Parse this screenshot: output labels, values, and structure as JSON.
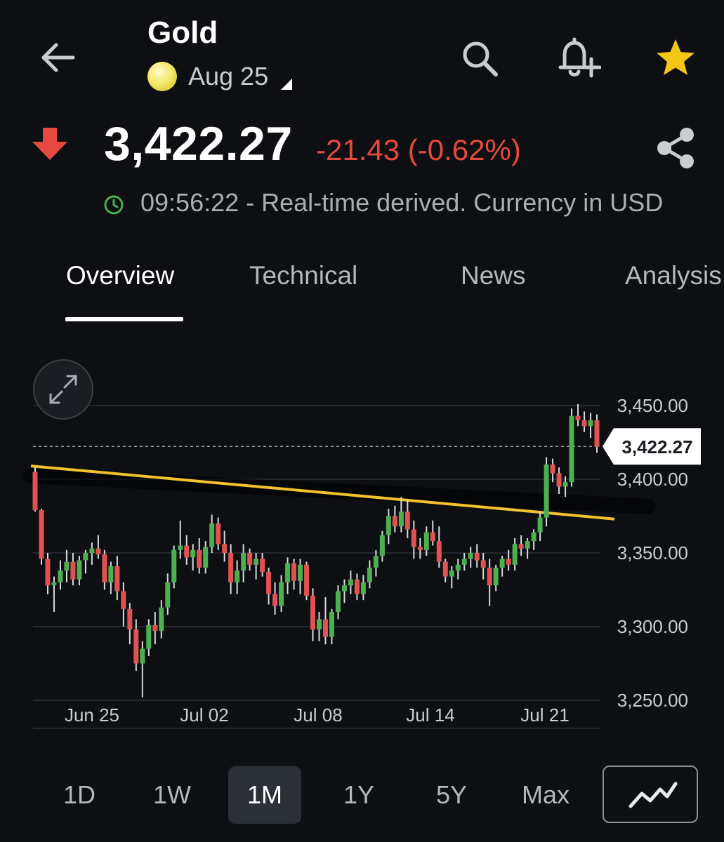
{
  "header": {
    "title": "Gold",
    "contract": "Aug 25",
    "back_icon": "arrow-left-icon",
    "search_icon": "search-icon",
    "alert_icon": "bell-plus-icon",
    "watchlist_icon": "star-icon",
    "star_color": "#f5c518"
  },
  "quote": {
    "price": "3,422.27",
    "change": "-21.43 (-0.62%)",
    "direction_icon": "arrow-down-icon",
    "share_icon": "share-icon",
    "down_color": "#e6493f"
  },
  "status": {
    "clock_icon": "clock-icon",
    "text": "09:56:22 - Real-time derived. Currency in USD"
  },
  "tabs": [
    {
      "label": "Overview",
      "active": true
    },
    {
      "label": "Technical"
    },
    {
      "label": "News"
    },
    {
      "label": "Analysis"
    }
  ],
  "chart_data": {
    "type": "candlestick",
    "y_ticks": [
      "3,450.00",
      "3,400.00",
      "3,350.00",
      "3,300.00",
      "3,250.00"
    ],
    "x_ticks": [
      "Jun 25",
      "Jul 02",
      "Jul 08",
      "Jul 14",
      "Jul 21"
    ],
    "ylim": [
      3250,
      3450
    ],
    "last_price_label": "3,422.27",
    "last_price": 3422.27,
    "up_color": "#4caf50",
    "down_color": "#e05252",
    "trendline_color": "#f2c12e",
    "trendline": [
      [
        0,
        3409
      ],
      [
        100,
        3373
      ]
    ],
    "candles": [
      [
        3405,
        3408,
        3378,
        3379
      ],
      [
        3379,
        3380,
        3342,
        3346
      ],
      [
        3346,
        3350,
        3322,
        3328
      ],
      [
        3328,
        3334,
        3310,
        3330
      ],
      [
        3330,
        3345,
        3325,
        3338
      ],
      [
        3338,
        3352,
        3330,
        3344
      ],
      [
        3344,
        3350,
        3328,
        3332
      ],
      [
        3332,
        3348,
        3328,
        3345
      ],
      [
        3345,
        3352,
        3336,
        3350
      ],
      [
        3350,
        3357,
        3342,
        3353
      ],
      [
        3353,
        3362,
        3346,
        3349
      ],
      [
        3349,
        3352,
        3325,
        3330
      ],
      [
        3330,
        3344,
        3322,
        3341
      ],
      [
        3341,
        3348,
        3318,
        3324
      ],
      [
        3324,
        3330,
        3300,
        3312
      ],
      [
        3312,
        3316,
        3288,
        3298
      ],
      [
        3298,
        3305,
        3270,
        3275
      ],
      [
        3275,
        3290,
        3252,
        3285
      ],
      [
        3285,
        3305,
        3280,
        3301
      ],
      [
        3301,
        3310,
        3288,
        3297
      ],
      [
        3297,
        3318,
        3292,
        3313
      ],
      [
        3313,
        3336,
        3308,
        3330
      ],
      [
        3330,
        3355,
        3326,
        3352
      ],
      [
        3352,
        3372,
        3346,
        3355
      ],
      [
        3355,
        3362,
        3342,
        3347
      ],
      [
        3347,
        3356,
        3338,
        3352
      ],
      [
        3352,
        3360,
        3336,
        3340
      ],
      [
        3340,
        3358,
        3336,
        3354
      ],
      [
        3354,
        3376,
        3350,
        3370
      ],
      [
        3370,
        3374,
        3352,
        3356
      ],
      [
        3356,
        3365,
        3344,
        3350
      ],
      [
        3350,
        3356,
        3322,
        3330
      ],
      [
        3330,
        3345,
        3322,
        3338
      ],
      [
        3338,
        3356,
        3330,
        3350
      ],
      [
        3350,
        3353,
        3338,
        3342
      ],
      [
        3342,
        3350,
        3332,
        3346
      ],
      [
        3346,
        3350,
        3334,
        3337
      ],
      [
        3337,
        3340,
        3315,
        3322
      ],
      [
        3322,
        3330,
        3308,
        3314
      ],
      [
        3314,
        3335,
        3310,
        3330
      ],
      [
        3330,
        3347,
        3322,
        3343
      ],
      [
        3343,
        3346,
        3325,
        3331
      ],
      [
        3331,
        3346,
        3322,
        3342
      ],
      [
        3342,
        3344,
        3318,
        3321
      ],
      [
        3321,
        3326,
        3290,
        3298
      ],
      [
        3298,
        3310,
        3290,
        3305
      ],
      [
        3305,
        3320,
        3288,
        3293
      ],
      [
        3293,
        3312,
        3288,
        3310
      ],
      [
        3310,
        3328,
        3305,
        3324
      ],
      [
        3324,
        3332,
        3316,
        3328
      ],
      [
        3328,
        3338,
        3322,
        3332
      ],
      [
        3332,
        3336,
        3318,
        3322
      ],
      [
        3322,
        3335,
        3318,
        3330
      ],
      [
        3330,
        3345,
        3326,
        3340
      ],
      [
        3340,
        3352,
        3334,
        3348
      ],
      [
        3348,
        3365,
        3344,
        3362
      ],
      [
        3362,
        3380,
        3356,
        3375
      ],
      [
        3375,
        3382,
        3364,
        3368
      ],
      [
        3368,
        3388,
        3364,
        3378
      ],
      [
        3378,
        3386,
        3360,
        3366
      ],
      [
        3366,
        3372,
        3346,
        3354
      ],
      [
        3354,
        3360,
        3346,
        3352
      ],
      [
        3352,
        3368,
        3348,
        3364
      ],
      [
        3364,
        3372,
        3355,
        3358
      ],
      [
        3358,
        3368,
        3340,
        3344
      ],
      [
        3344,
        3346,
        3330,
        3334
      ],
      [
        3334,
        3341,
        3326,
        3338
      ],
      [
        3338,
        3346,
        3332,
        3342
      ],
      [
        3342,
        3350,
        3338,
        3346
      ],
      [
        3346,
        3354,
        3340,
        3350
      ],
      [
        3350,
        3356,
        3340,
        3345
      ],
      [
        3345,
        3350,
        3332,
        3340
      ],
      [
        3340,
        3346,
        3314,
        3328
      ],
      [
        3328,
        3342,
        3324,
        3340
      ],
      [
        3340,
        3348,
        3334,
        3346
      ],
      [
        3346,
        3352,
        3338,
        3342
      ],
      [
        3342,
        3360,
        3338,
        3356
      ],
      [
        3356,
        3362,
        3348,
        3353
      ],
      [
        3353,
        3360,
        3346,
        3358
      ],
      [
        3358,
        3366,
        3352,
        3364
      ],
      [
        3364,
        3378,
        3358,
        3374
      ],
      [
        3374,
        3415,
        3368,
        3410
      ],
      [
        3410,
        3414,
        3398,
        3404
      ],
      [
        3404,
        3408,
        3390,
        3395
      ],
      [
        3395,
        3402,
        3388,
        3398
      ],
      [
        3398,
        3448,
        3395,
        3443
      ],
      [
        3443,
        3451,
        3436,
        3440
      ],
      [
        3440,
        3446,
        3432,
        3436
      ],
      [
        3436,
        3445,
        3428,
        3440
      ],
      [
        3440,
        3444,
        3418,
        3422
      ]
    ]
  },
  "ranges": [
    {
      "label": "1D"
    },
    {
      "label": "1W"
    },
    {
      "label": "1M",
      "active": true
    },
    {
      "label": "1Y"
    },
    {
      "label": "5Y"
    },
    {
      "label": "Max"
    }
  ],
  "chart_type_icon": "line-chart-icon",
  "expand_icon": "expand-icon"
}
